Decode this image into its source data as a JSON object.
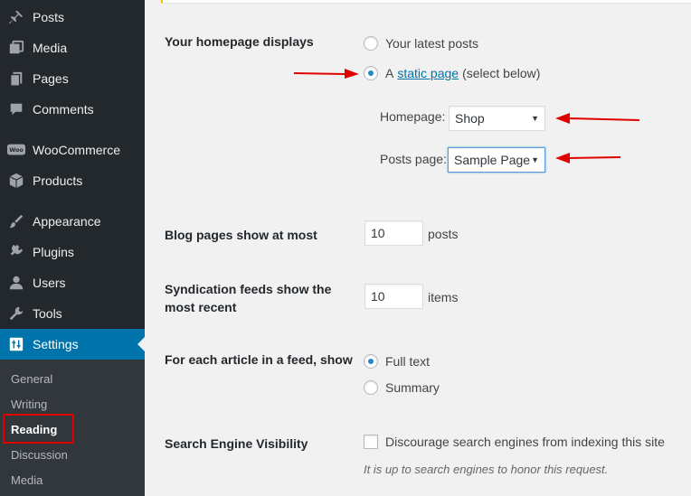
{
  "sidebar": {
    "items": [
      {
        "label": "Posts",
        "icon": "pushpin-icon"
      },
      {
        "label": "Media",
        "icon": "media-icon"
      },
      {
        "label": "Pages",
        "icon": "pages-icon"
      },
      {
        "label": "Comments",
        "icon": "comment-icon"
      },
      {
        "label": "WooCommerce",
        "icon": "woocommerce-icon"
      },
      {
        "label": "Products",
        "icon": "box-icon"
      },
      {
        "label": "Appearance",
        "icon": "brush-icon"
      },
      {
        "label": "Plugins",
        "icon": "plug-icon"
      },
      {
        "label": "Users",
        "icon": "user-icon"
      },
      {
        "label": "Tools",
        "icon": "wrench-icon"
      },
      {
        "label": "Settings",
        "icon": "settings-icon"
      }
    ],
    "submenu": [
      "General",
      "Writing",
      "Reading",
      "Discussion",
      "Media"
    ]
  },
  "reading": {
    "homepage_displays": {
      "label": "Your homepage displays",
      "option_latest": "Your latest posts",
      "option_static_prefix": "A",
      "option_static_link": "static page",
      "option_static_suffix": "(select below)",
      "selected": "static"
    },
    "homepage": {
      "label": "Homepage:",
      "value": "Shop"
    },
    "posts_page": {
      "label": "Posts page:",
      "value": "Sample Page"
    },
    "blog_pages": {
      "label": "Blog pages show at most",
      "value": "10",
      "suffix": "posts"
    },
    "syndication": {
      "label_line1": "Syndication feeds show the",
      "label_line2": "most recent",
      "value": "10",
      "suffix": "items"
    },
    "feed_article": {
      "label": "For each article in a feed, show",
      "option_full": "Full text",
      "option_summary": "Summary",
      "selected": "full"
    },
    "search_visibility": {
      "label": "Search Engine Visibility",
      "checkbox_label": "Discourage search engines from indexing this site",
      "checked": false,
      "description": "It is up to search engines to honor this request."
    }
  },
  "colors": {
    "sidebar": "#23282d",
    "active": "#0073aa",
    "annotation": "#e00000"
  }
}
